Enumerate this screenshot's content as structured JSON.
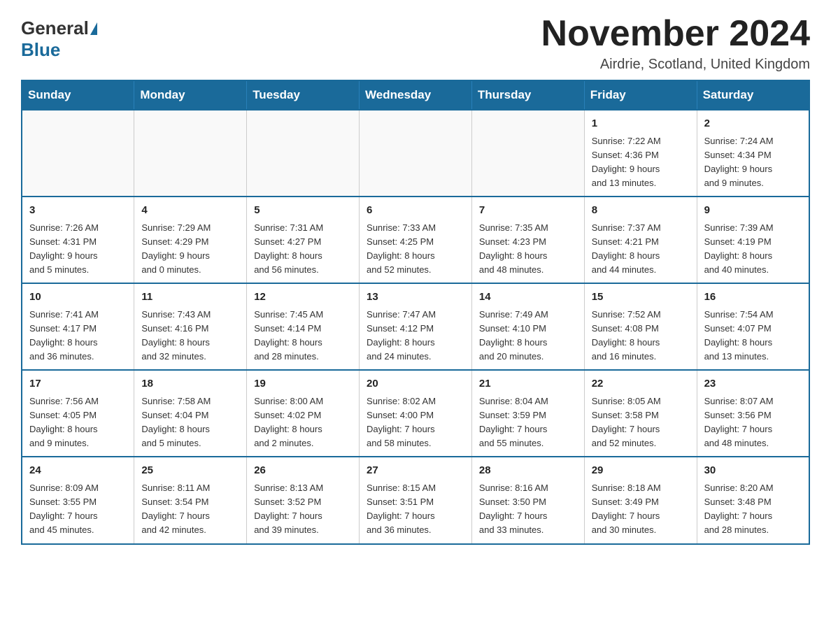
{
  "header": {
    "logo_general": "General",
    "logo_blue": "Blue",
    "month_title": "November 2024",
    "location": "Airdrie, Scotland, United Kingdom"
  },
  "days_of_week": [
    "Sunday",
    "Monday",
    "Tuesday",
    "Wednesday",
    "Thursday",
    "Friday",
    "Saturday"
  ],
  "weeks": [
    [
      {
        "day": "",
        "info": ""
      },
      {
        "day": "",
        "info": ""
      },
      {
        "day": "",
        "info": ""
      },
      {
        "day": "",
        "info": ""
      },
      {
        "day": "",
        "info": ""
      },
      {
        "day": "1",
        "info": "Sunrise: 7:22 AM\nSunset: 4:36 PM\nDaylight: 9 hours\nand 13 minutes."
      },
      {
        "day": "2",
        "info": "Sunrise: 7:24 AM\nSunset: 4:34 PM\nDaylight: 9 hours\nand 9 minutes."
      }
    ],
    [
      {
        "day": "3",
        "info": "Sunrise: 7:26 AM\nSunset: 4:31 PM\nDaylight: 9 hours\nand 5 minutes."
      },
      {
        "day": "4",
        "info": "Sunrise: 7:29 AM\nSunset: 4:29 PM\nDaylight: 9 hours\nand 0 minutes."
      },
      {
        "day": "5",
        "info": "Sunrise: 7:31 AM\nSunset: 4:27 PM\nDaylight: 8 hours\nand 56 minutes."
      },
      {
        "day": "6",
        "info": "Sunrise: 7:33 AM\nSunset: 4:25 PM\nDaylight: 8 hours\nand 52 minutes."
      },
      {
        "day": "7",
        "info": "Sunrise: 7:35 AM\nSunset: 4:23 PM\nDaylight: 8 hours\nand 48 minutes."
      },
      {
        "day": "8",
        "info": "Sunrise: 7:37 AM\nSunset: 4:21 PM\nDaylight: 8 hours\nand 44 minutes."
      },
      {
        "day": "9",
        "info": "Sunrise: 7:39 AM\nSunset: 4:19 PM\nDaylight: 8 hours\nand 40 minutes."
      }
    ],
    [
      {
        "day": "10",
        "info": "Sunrise: 7:41 AM\nSunset: 4:17 PM\nDaylight: 8 hours\nand 36 minutes."
      },
      {
        "day": "11",
        "info": "Sunrise: 7:43 AM\nSunset: 4:16 PM\nDaylight: 8 hours\nand 32 minutes."
      },
      {
        "day": "12",
        "info": "Sunrise: 7:45 AM\nSunset: 4:14 PM\nDaylight: 8 hours\nand 28 minutes."
      },
      {
        "day": "13",
        "info": "Sunrise: 7:47 AM\nSunset: 4:12 PM\nDaylight: 8 hours\nand 24 minutes."
      },
      {
        "day": "14",
        "info": "Sunrise: 7:49 AM\nSunset: 4:10 PM\nDaylight: 8 hours\nand 20 minutes."
      },
      {
        "day": "15",
        "info": "Sunrise: 7:52 AM\nSunset: 4:08 PM\nDaylight: 8 hours\nand 16 minutes."
      },
      {
        "day": "16",
        "info": "Sunrise: 7:54 AM\nSunset: 4:07 PM\nDaylight: 8 hours\nand 13 minutes."
      }
    ],
    [
      {
        "day": "17",
        "info": "Sunrise: 7:56 AM\nSunset: 4:05 PM\nDaylight: 8 hours\nand 9 minutes."
      },
      {
        "day": "18",
        "info": "Sunrise: 7:58 AM\nSunset: 4:04 PM\nDaylight: 8 hours\nand 5 minutes."
      },
      {
        "day": "19",
        "info": "Sunrise: 8:00 AM\nSunset: 4:02 PM\nDaylight: 8 hours\nand 2 minutes."
      },
      {
        "day": "20",
        "info": "Sunrise: 8:02 AM\nSunset: 4:00 PM\nDaylight: 7 hours\nand 58 minutes."
      },
      {
        "day": "21",
        "info": "Sunrise: 8:04 AM\nSunset: 3:59 PM\nDaylight: 7 hours\nand 55 minutes."
      },
      {
        "day": "22",
        "info": "Sunrise: 8:05 AM\nSunset: 3:58 PM\nDaylight: 7 hours\nand 52 minutes."
      },
      {
        "day": "23",
        "info": "Sunrise: 8:07 AM\nSunset: 3:56 PM\nDaylight: 7 hours\nand 48 minutes."
      }
    ],
    [
      {
        "day": "24",
        "info": "Sunrise: 8:09 AM\nSunset: 3:55 PM\nDaylight: 7 hours\nand 45 minutes."
      },
      {
        "day": "25",
        "info": "Sunrise: 8:11 AM\nSunset: 3:54 PM\nDaylight: 7 hours\nand 42 minutes."
      },
      {
        "day": "26",
        "info": "Sunrise: 8:13 AM\nSunset: 3:52 PM\nDaylight: 7 hours\nand 39 minutes."
      },
      {
        "day": "27",
        "info": "Sunrise: 8:15 AM\nSunset: 3:51 PM\nDaylight: 7 hours\nand 36 minutes."
      },
      {
        "day": "28",
        "info": "Sunrise: 8:16 AM\nSunset: 3:50 PM\nDaylight: 7 hours\nand 33 minutes."
      },
      {
        "day": "29",
        "info": "Sunrise: 8:18 AM\nSunset: 3:49 PM\nDaylight: 7 hours\nand 30 minutes."
      },
      {
        "day": "30",
        "info": "Sunrise: 8:20 AM\nSunset: 3:48 PM\nDaylight: 7 hours\nand 28 minutes."
      }
    ]
  ]
}
